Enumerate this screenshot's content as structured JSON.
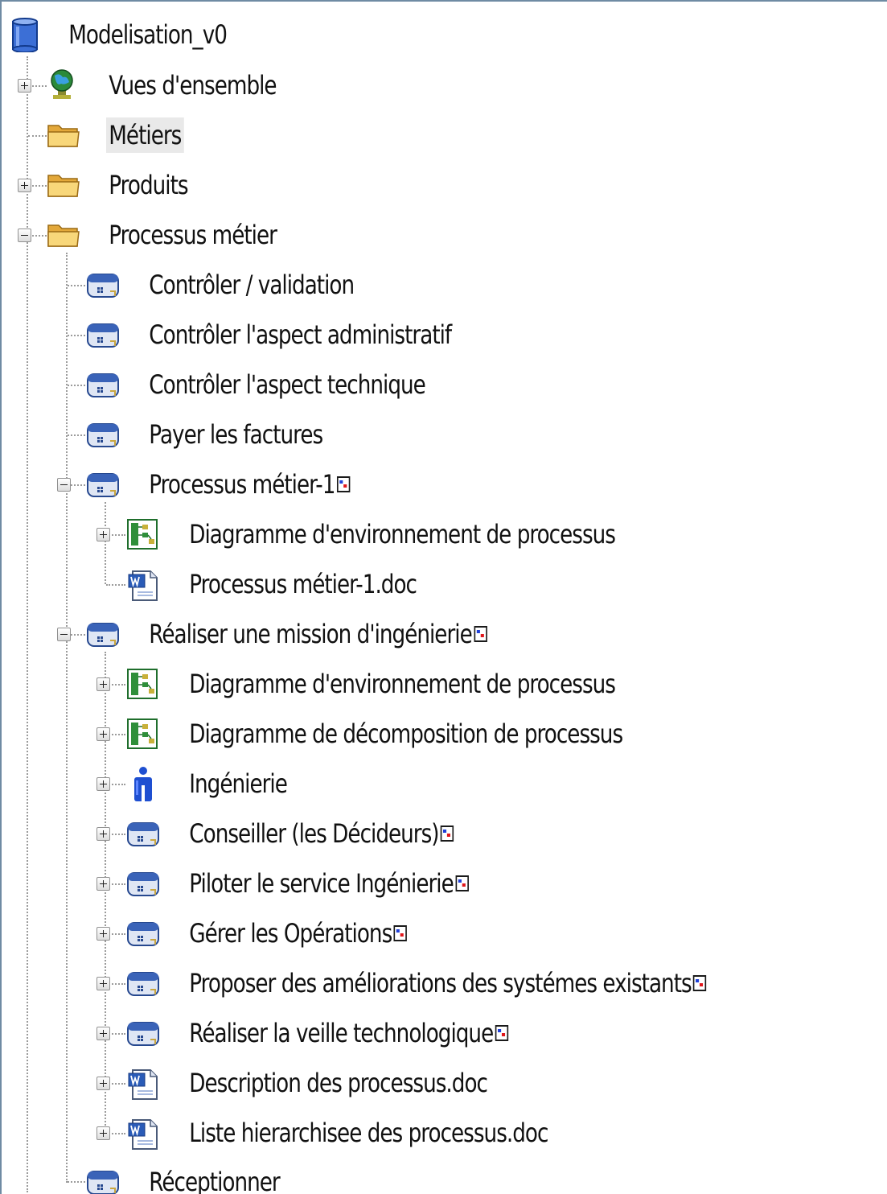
{
  "tree": {
    "root": {
      "label": "Modelisation_v0",
      "icon": "database-icon"
    },
    "nodes": [
      {
        "label": "Vues d'ensemble",
        "icon": "globe-icon",
        "expander": "plus"
      },
      {
        "label": "Métiers",
        "icon": "folder-icon",
        "expander": "none",
        "selected": true
      },
      {
        "label": "Produits",
        "icon": "folder-icon",
        "expander": "plus"
      },
      {
        "label": "Processus métier",
        "icon": "folder-icon",
        "expander": "minus"
      },
      {
        "label": "Contrôler / validation",
        "icon": "process-icon",
        "expander": "none"
      },
      {
        "label": "Contrôler l'aspect administratif",
        "icon": "process-icon",
        "expander": "none"
      },
      {
        "label": "Contrôler l'aspect technique",
        "icon": "process-icon",
        "expander": "none"
      },
      {
        "label": "Payer les factures",
        "icon": "process-icon",
        "expander": "none"
      },
      {
        "label": "Processus métier-1",
        "icon": "process-icon",
        "expander": "minus",
        "shortcut": true
      },
      {
        "label": "Diagramme d'environnement de processus",
        "icon": "diagram-icon",
        "expander": "plus"
      },
      {
        "label": "Processus métier-1.doc",
        "icon": "word-doc-icon",
        "expander": "none"
      },
      {
        "label": "Réaliser une mission d'ingénierie",
        "icon": "process-icon",
        "expander": "minus",
        "shortcut": true
      },
      {
        "label": "Diagramme d'environnement de processus",
        "icon": "diagram-icon",
        "expander": "plus"
      },
      {
        "label": "Diagramme de décomposition de processus",
        "icon": "diagram-icon",
        "expander": "plus"
      },
      {
        "label": "Ingénierie",
        "icon": "person-icon",
        "expander": "plus"
      },
      {
        "label": "Conseiller (les Décideurs)",
        "icon": "process-icon",
        "expander": "plus",
        "shortcut": true
      },
      {
        "label": "Piloter le service Ingénierie",
        "icon": "process-icon",
        "expander": "plus",
        "shortcut": true
      },
      {
        "label": "Gérer les Opérations",
        "icon": "process-icon",
        "expander": "plus",
        "shortcut": true
      },
      {
        "label": "Proposer des améliorations des systémes existants",
        "icon": "process-icon",
        "expander": "plus",
        "shortcut": true
      },
      {
        "label": "Réaliser la veille technologique",
        "icon": "process-icon",
        "expander": "plus",
        "shortcut": true
      },
      {
        "label": "Description des processus.doc",
        "icon": "word-doc-icon",
        "expander": "plus"
      },
      {
        "label": "Liste hierarchisee des processus.doc",
        "icon": "word-doc-icon",
        "expander": "plus"
      },
      {
        "label": "Réceptionner",
        "icon": "process-icon",
        "expander": "none"
      }
    ]
  },
  "colors": {
    "selection": "#e9e9e9",
    "connector": "#9b9b9b",
    "process_icon": "#3a63b8",
    "folder": "#f2c45a",
    "diagram": "#2f8f3a",
    "person": "#1e4fd1",
    "word": "#2a5bb7"
  }
}
